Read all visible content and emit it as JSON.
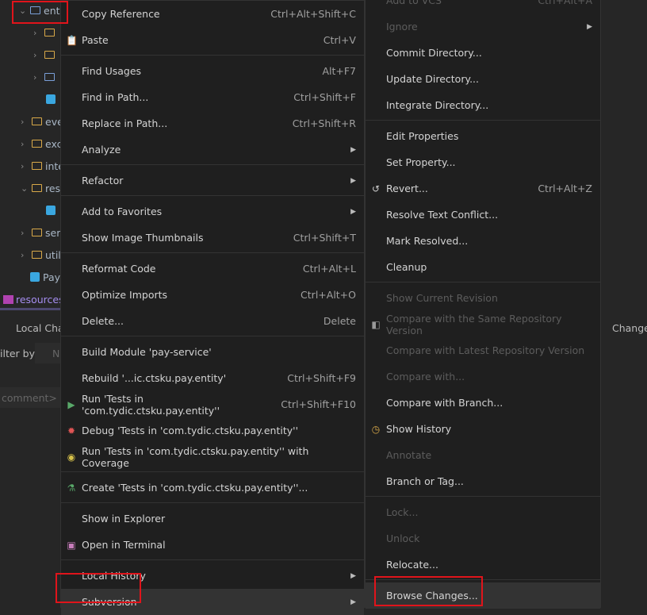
{
  "tree": [
    {
      "label": "ent",
      "icon": "folder-icon",
      "chev": "v"
    },
    {
      "label": "",
      "icon": "folder-icon",
      "chev": ">"
    },
    {
      "label": "",
      "icon": "folder-icon",
      "chev": ">"
    },
    {
      "label": "",
      "icon": "folder-icon",
      "chev": ">"
    },
    {
      "label": "",
      "icon": "class-icon",
      "chev": ""
    },
    {
      "label": "eve",
      "icon": "folder-icon",
      "chev": ">"
    },
    {
      "label": "exc",
      "icon": "folder-icon",
      "chev": ">"
    },
    {
      "label": "inte",
      "icon": "folder-icon",
      "chev": ">"
    },
    {
      "label": "res",
      "icon": "folder-icon",
      "chev": "v"
    },
    {
      "label": "",
      "icon": "class-icon",
      "chev": ""
    },
    {
      "label": "ser",
      "icon": "folder-icon",
      "chev": ">"
    },
    {
      "label": "util",
      "icon": "folder-icon",
      "chev": ">"
    },
    {
      "label": "Pay",
      "icon": "class-icon",
      "chev": ""
    }
  ],
  "resources": "resources",
  "bottom": {
    "tab": "Local Cha",
    "filter_label": "ilter by",
    "filter_value": "N",
    "comment_placeholder": "comment>",
    "right_tab": "Change"
  },
  "menu1": [
    {
      "label": "Copy Reference",
      "shortcut": "Ctrl+Alt+Shift+C"
    },
    {
      "label": "Paste",
      "shortcut": "Ctrl+V",
      "icon": "clipboard-icon"
    },
    {
      "sep": true
    },
    {
      "label": "Find Usages",
      "shortcut": "Alt+F7"
    },
    {
      "label": "Find in Path...",
      "shortcut": "Ctrl+Shift+F"
    },
    {
      "label": "Replace in Path...",
      "shortcut": "Ctrl+Shift+R"
    },
    {
      "label": "Analyze",
      "submenu": true
    },
    {
      "sep": true
    },
    {
      "label": "Refactor",
      "submenu": true
    },
    {
      "sep": true
    },
    {
      "label": "Add to Favorites",
      "submenu": true
    },
    {
      "label": "Show Image Thumbnails",
      "shortcut": "Ctrl+Shift+T"
    },
    {
      "sep": true
    },
    {
      "label": "Reformat Code",
      "shortcut": "Ctrl+Alt+L"
    },
    {
      "label": "Optimize Imports",
      "shortcut": "Ctrl+Alt+O"
    },
    {
      "label": "Delete...",
      "shortcut": "Delete"
    },
    {
      "sep": true
    },
    {
      "label": "Build Module 'pay-service'"
    },
    {
      "label": "Rebuild '...ic.ctsku.pay.entity'",
      "shortcut": "Ctrl+Shift+F9"
    },
    {
      "label": "Run 'Tests in 'com.tydic.ctsku.pay.entity''",
      "shortcut": "Ctrl+Shift+F10",
      "icon": "run-icon"
    },
    {
      "label": "Debug 'Tests in 'com.tydic.ctsku.pay.entity''",
      "icon": "debug-icon"
    },
    {
      "label": "Run 'Tests in 'com.tydic.ctsku.pay.entity'' with Coverage",
      "icon": "coverage-icon"
    },
    {
      "sep": true
    },
    {
      "label": "Create 'Tests in 'com.tydic.ctsku.pay.entity''...",
      "icon": "test-icon"
    },
    {
      "sep": true
    },
    {
      "label": "Show in Explorer"
    },
    {
      "label": "Open in Terminal",
      "icon": "terminal-icon"
    },
    {
      "sep": true
    },
    {
      "label": "Local History",
      "submenu": true
    },
    {
      "label": "Subversion",
      "submenu": true,
      "highlighted": true
    }
  ],
  "menu2": [
    {
      "label": "Add to VCS",
      "shortcut": "Ctrl+Alt+A",
      "disabled": true
    },
    {
      "label": "Ignore",
      "submenu": true,
      "disabled": true
    },
    {
      "label": "Commit Directory..."
    },
    {
      "label": "Update Directory..."
    },
    {
      "label": "Integrate Directory..."
    },
    {
      "sep": true
    },
    {
      "label": "Edit Properties"
    },
    {
      "label": "Set Property..."
    },
    {
      "label": "Revert...",
      "shortcut": "Ctrl+Alt+Z",
      "icon": "revert-icon"
    },
    {
      "label": "Resolve Text Conflict..."
    },
    {
      "label": "Mark Resolved..."
    },
    {
      "label": "Cleanup"
    },
    {
      "sep": true
    },
    {
      "label": "Show Current Revision",
      "disabled": true
    },
    {
      "label": "Compare with the Same Repository Version",
      "disabled": true,
      "icon": "diff-icon"
    },
    {
      "label": "Compare with Latest Repository Version",
      "disabled": true
    },
    {
      "label": "Compare with...",
      "disabled": true
    },
    {
      "label": "Compare with Branch..."
    },
    {
      "label": "Show History",
      "icon": "history-icon"
    },
    {
      "label": "Annotate",
      "disabled": true
    },
    {
      "label": "Branch or Tag..."
    },
    {
      "sep": true
    },
    {
      "label": "Lock...",
      "disabled": true
    },
    {
      "label": "Unlock",
      "disabled": true
    },
    {
      "label": "Relocate..."
    },
    {
      "sep": true
    },
    {
      "label": "Browse Changes...",
      "highlighted": true
    }
  ],
  "icons": {
    "run-icon": "▶",
    "debug-icon": "✹",
    "coverage-icon": "◉",
    "test-icon": "⚗",
    "terminal-icon": "▣",
    "clipboard-icon": "📋",
    "revert-icon": "↺",
    "diff-icon": "◧",
    "history-icon": "◷"
  },
  "icon_colors": {
    "run-icon": "#59a869",
    "debug-icon": "#e05555",
    "coverage-icon": "#d6c14a",
    "test-icon": "#59a869",
    "terminal-icon": "#c77dbb",
    "clipboard-icon": "#d9a949",
    "revert-icon": "#ccc",
    "diff-icon": "#999",
    "history-icon": "#d9a949"
  },
  "highlight_color": "#e0141b"
}
